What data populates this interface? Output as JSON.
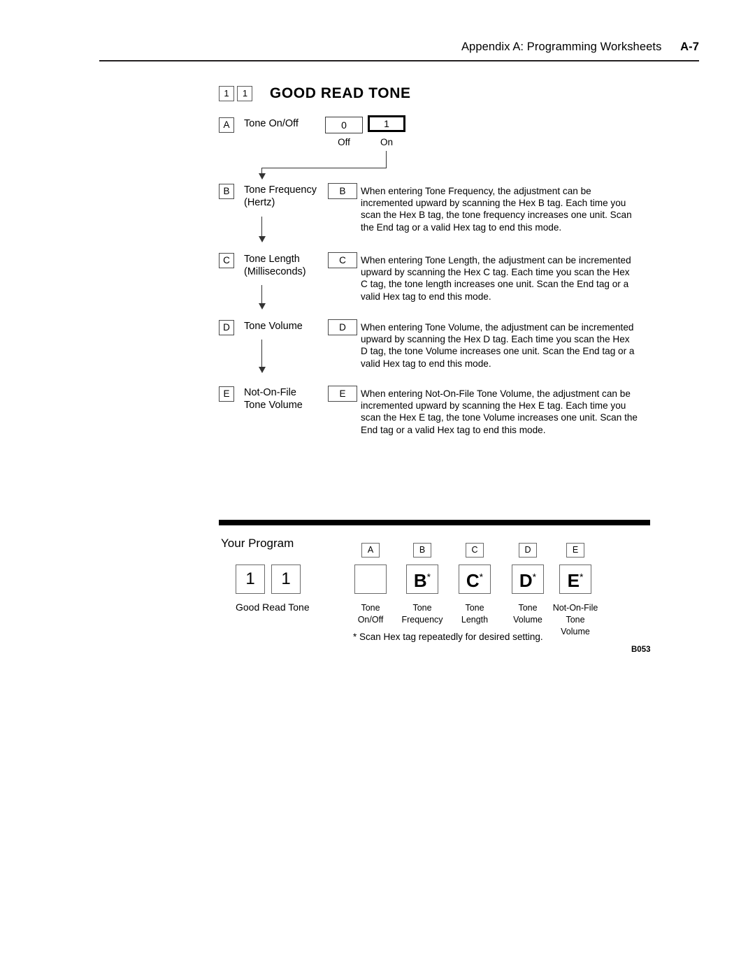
{
  "header": {
    "title": "Appendix A:  Programming Worksheets",
    "page_number": "A-7"
  },
  "title_row": {
    "code_1": "1",
    "code_2": "1",
    "title": "GOOD READ TONE"
  },
  "parameters": [
    {
      "letter": "A",
      "label": "Tone On/Off",
      "sublabel": "",
      "options": [
        {
          "value": "0",
          "caption": "Off",
          "selected": false
        },
        {
          "value": "1",
          "caption": "On",
          "selected": true
        }
      ]
    },
    {
      "letter": "B",
      "label": "Tone Frequency",
      "sublabel": "(Hertz)",
      "description": "When entering Tone Frequency, the adjustment can be incremented upward by scanning the Hex B tag. Each time you scan the Hex B tag, the tone frequency increases one unit. Scan the End tag or a valid Hex tag to end this mode."
    },
    {
      "letter": "C",
      "label": "Tone Length",
      "sublabel": "(Milliseconds)",
      "description": "When entering Tone Length, the adjustment can be incremented upward by scanning the Hex C tag. Each time you scan the Hex C tag, the tone length increases one unit. Scan the End tag or a valid Hex tag to end this mode."
    },
    {
      "letter": "D",
      "label": "Tone Volume",
      "sublabel": "",
      "description": "When entering Tone Volume, the adjustment can be incremented upward by scanning the Hex D tag. Each time you scan the Hex D tag, the tone Volume increases one unit. Scan the End tag or a valid Hex tag to end this mode."
    },
    {
      "letter": "E",
      "label": "Not-On-File",
      "sublabel": "Tone Volume",
      "description": "When entering Not-On-File Tone Volume, the adjustment can be incremented upward by scanning the Hex E tag. Each time you scan the Hex E tag, the tone Volume increases one unit. Scan the End tag or a valid Hex tag to end this mode."
    }
  ],
  "your_program": {
    "title": "Your Program",
    "code_boxes": [
      "1",
      "1"
    ],
    "code_caption": "Good Read Tone",
    "columns": [
      {
        "tag": "A",
        "value": "",
        "star": "",
        "caption": "Tone\nOn/Off"
      },
      {
        "tag": "B",
        "value": "B",
        "star": "*",
        "caption": "Tone\nFrequency"
      },
      {
        "tag": "C",
        "value": "C",
        "star": "*",
        "caption": "Tone\nLength"
      },
      {
        "tag": "D",
        "value": "D",
        "star": "*",
        "caption": "Tone\nVolume"
      },
      {
        "tag": "E",
        "value": "E",
        "star": "*",
        "caption": "Not-On-File\nTone\nVolume"
      }
    ],
    "footnote": "* Scan Hex tag repeatedly for desired setting.",
    "figure_id": "B053"
  }
}
